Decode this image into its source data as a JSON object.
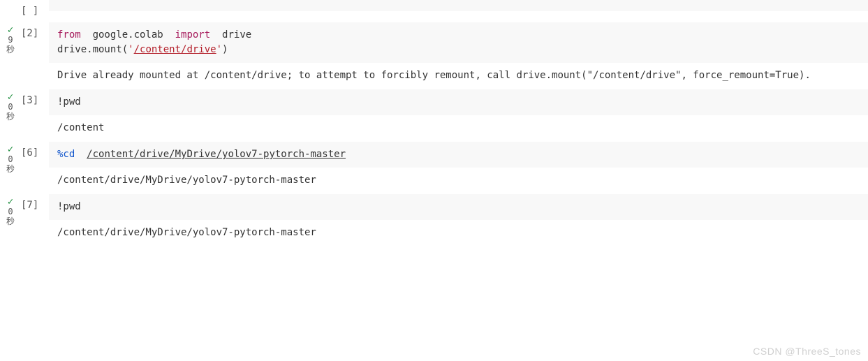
{
  "gutter": {
    "check_glyph": "✓",
    "sec": "秒",
    "c1_time": "9",
    "c2_time": "0",
    "c3_time": "0",
    "c4_time": "0"
  },
  "cell0": {
    "prompt": "[ ]",
    "code": ""
  },
  "cell1": {
    "prompt": "[2]",
    "kw_from": "from",
    "module": "google.colab",
    "kw_import": "import",
    "name": "drive",
    "line2_left": "drive.mount(",
    "q1": "'",
    "path_str": "/content/drive",
    "q2": "'",
    "line2_right": ")",
    "output": "Drive already mounted at /content/drive; to attempt to forcibly remount, call drive.mount(\"/content/drive\", force_remount=True)."
  },
  "cell2": {
    "prompt": "[3]",
    "code": "!pwd",
    "output": "/content"
  },
  "cell3": {
    "prompt": "[6]",
    "magic": "%cd",
    "gap": "  ",
    "path": "/content/drive/MyDrive/yolov7-pytorch-master",
    "output": "/content/drive/MyDrive/yolov7-pytorch-master"
  },
  "cell4": {
    "prompt": "[7]",
    "code": "!pwd",
    "output": "/content/drive/MyDrive/yolov7-pytorch-master"
  },
  "watermark": "CSDN @ThreeS_tones"
}
